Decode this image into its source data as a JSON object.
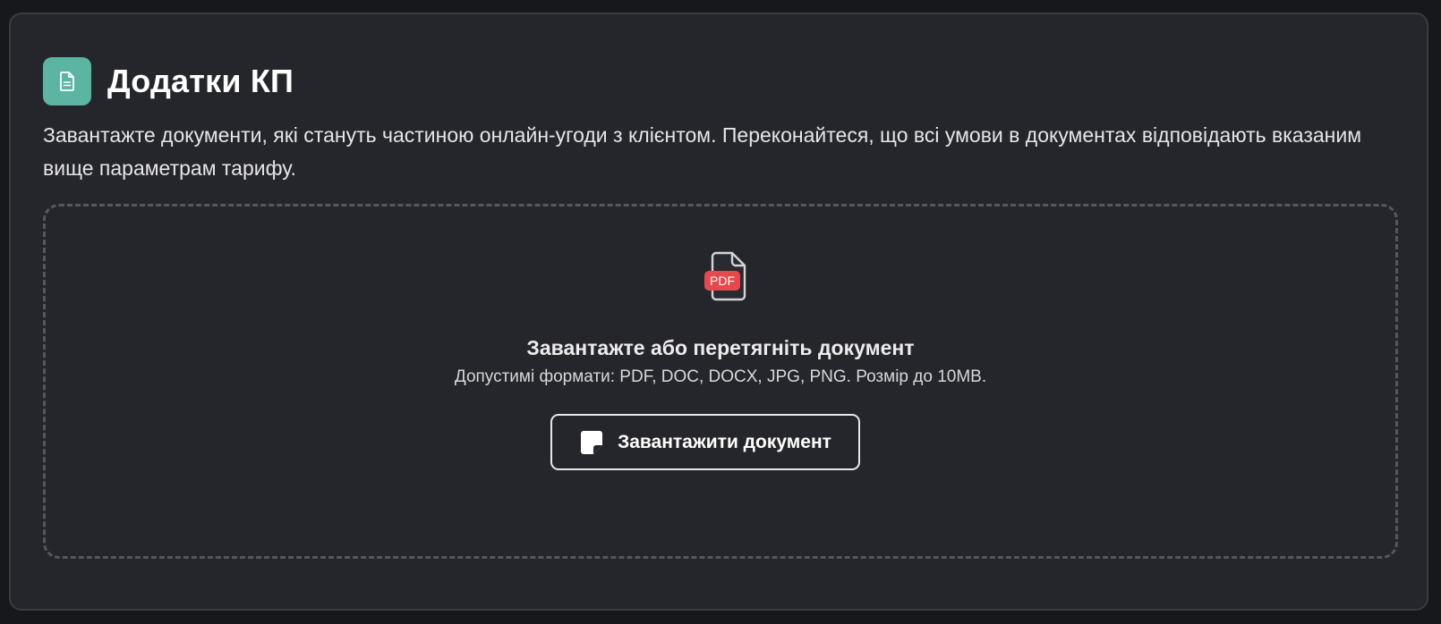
{
  "section": {
    "title": "Додатки КП",
    "description": "Завантажте документи, які стануть частиною онлайн-угоди з клієнтом. Переконайтеся, що всі умови в документах відповідають вказаним вище параметрам тарифу.",
    "icon": "document-icon",
    "accent_color": "#5bb5a2"
  },
  "dropzone": {
    "icon": "pdf-file-icon",
    "icon_badge": "PDF",
    "title": "Завантажте або перетягніть документ",
    "hint": "Допустимі формати: PDF, DOC, DOCX, JPG, PNG. Розмір до 10MB.",
    "badge_color": "#e5484d",
    "upload_button": {
      "label": "Завантажити документ",
      "icon": "file-upload-icon"
    }
  }
}
